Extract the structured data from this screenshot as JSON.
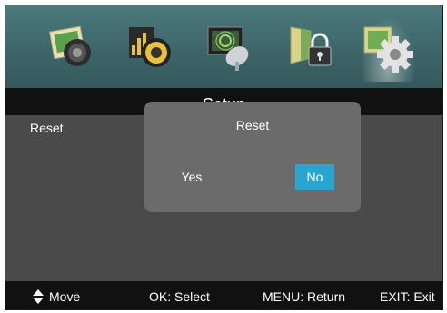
{
  "menu": {
    "icons": [
      {
        "icon": "picture-icon",
        "label": "Picture"
      },
      {
        "icon": "sound-icon",
        "label": "Sound"
      },
      {
        "icon": "channel-icon",
        "label": "Channel"
      },
      {
        "icon": "lock-icon",
        "label": "Lock"
      },
      {
        "icon": "setup-gear-icon",
        "label": "Setup",
        "active": true
      }
    ],
    "title": "Setup",
    "items": [
      "Reset"
    ]
  },
  "dialog": {
    "title": "Reset",
    "yes_label": "Yes",
    "no_label": "No",
    "selected": "No",
    "highlight_color": "#2aa5d0"
  },
  "footer": {
    "move_label": "Move",
    "select_label": "OK: Select",
    "return_label": "MENU: Return",
    "exit_label": "EXIT: Exit"
  },
  "colors": {
    "icon_bar": "#3c6467",
    "content_bg": "#4a4a4a",
    "dialog_bg": "#6b6b6b",
    "footer_bg": "#111111"
  }
}
